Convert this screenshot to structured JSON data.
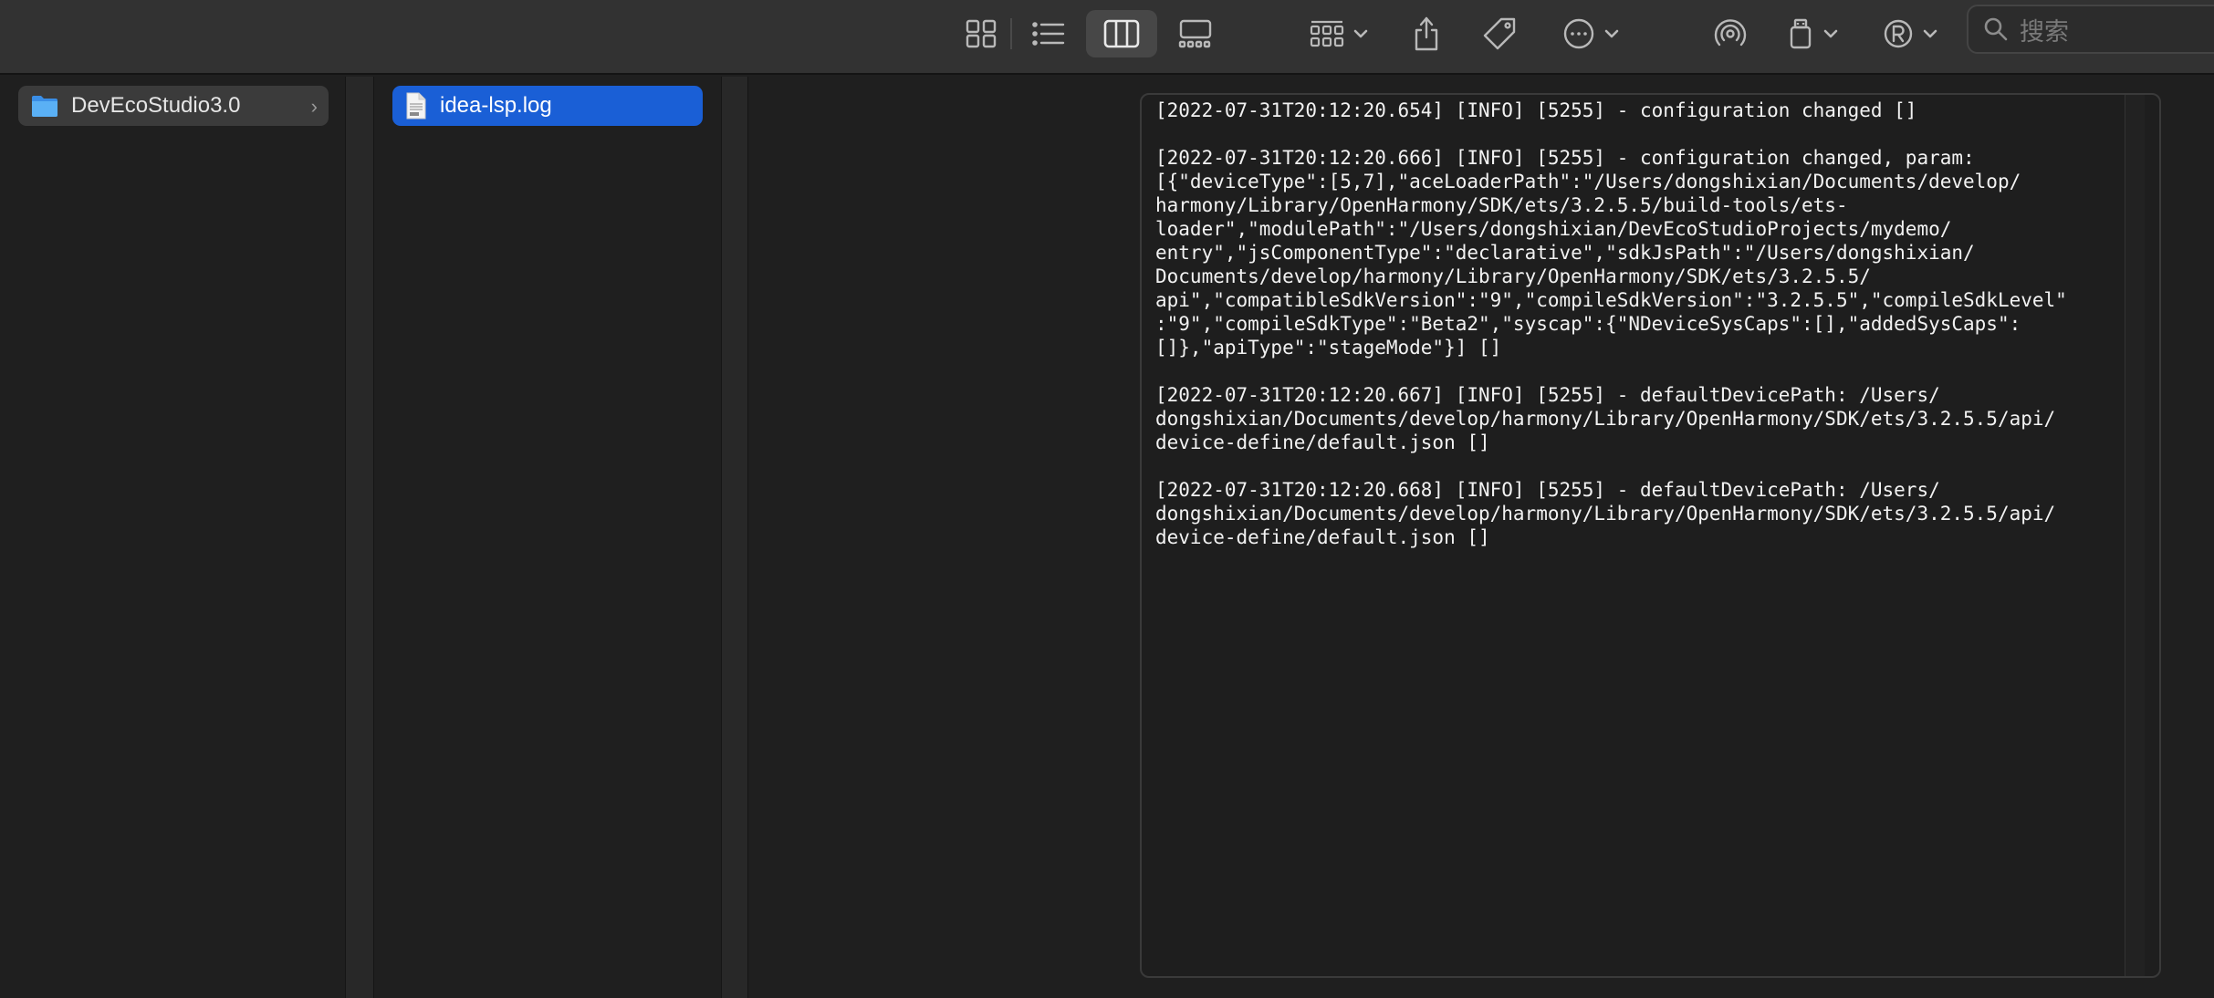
{
  "toolbar": {
    "view_icons": [
      "icon-view-icon",
      "list-view-icon",
      "column-view-icon",
      "gallery-view-icon"
    ],
    "search": {
      "placeholder": "搜索"
    }
  },
  "sidebar_column": {
    "folder": {
      "label": "DevEcoStudio3.0",
      "icon": "folder-icon"
    }
  },
  "file_column": {
    "file": {
      "label": "idea-lsp.log",
      "icon": "document-icon"
    }
  },
  "preview": {
    "log_lines": [
      "[2022-07-31T20:12:20.654] [INFO] [5255] - configuration changed []",
      "",
      "[2022-07-31T20:12:20.666] [INFO] [5255] - configuration changed, param:",
      "[{\"deviceType\":[5,7],\"aceLoaderPath\":\"/Users/dongshixian/Documents/develop/",
      "harmony/Library/OpenHarmony/SDK/ets/3.2.5.5/build-tools/ets-",
      "loader\",\"modulePath\":\"/Users/dongshixian/DevEcoStudioProjects/mydemo/",
      "entry\",\"jsComponentType\":\"declarative\",\"sdkJsPath\":\"/Users/dongshixian/",
      "Documents/develop/harmony/Library/OpenHarmony/SDK/ets/3.2.5.5/",
      "api\",\"compatibleSdkVersion\":\"9\",\"compileSdkVersion\":\"3.2.5.5\",\"compileSdkLevel\"",
      ":\"9\",\"compileSdkType\":\"Beta2\",\"syscap\":{\"NDeviceSysCaps\":[],\"addedSysCaps\":",
      "[]},\"apiType\":\"stageMode\"}] []",
      "",
      "[2022-07-31T20:12:20.667] [INFO] [5255] - defaultDevicePath: /Users/",
      "dongshixian/Documents/develop/harmony/Library/OpenHarmony/SDK/ets/3.2.5.5/api/",
      "device-define/default.json []",
      "",
      "[2022-07-31T20:12:20.668] [INFO] [5255] - defaultDevicePath: /Users/",
      "dongshixian/Documents/develop/harmony/Library/OpenHarmony/SDK/ets/3.2.5.5/api/",
      "device-define/default.json []"
    ]
  }
}
